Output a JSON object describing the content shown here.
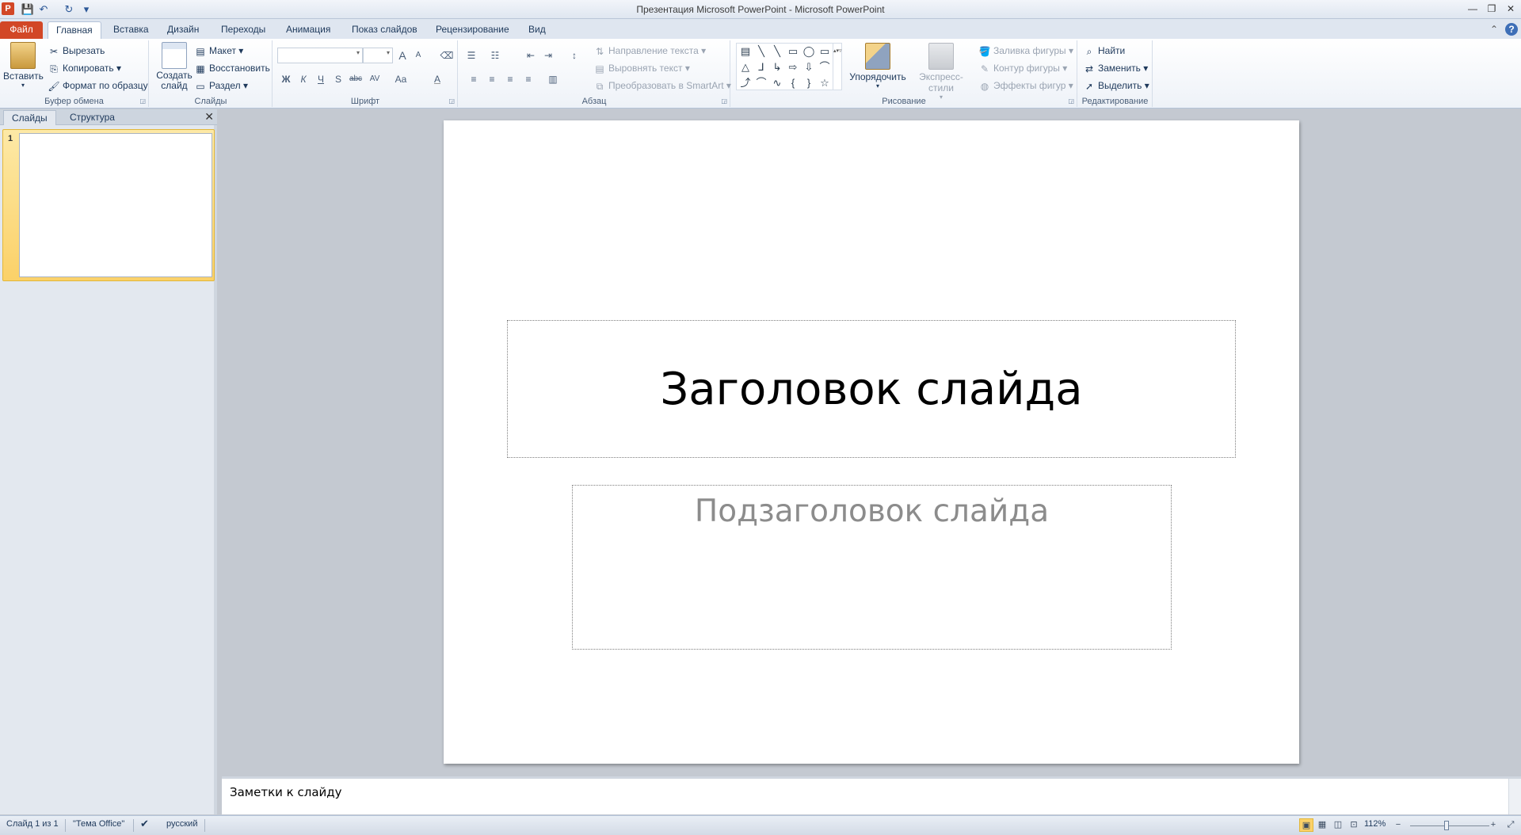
{
  "window": {
    "title": "Презентация Microsoft PowerPoint  -  Microsoft PowerPoint",
    "app_icon": "P",
    "qat": {
      "save_icon": "💾",
      "undo_icon": "↶",
      "redo_icon": "↻",
      "customize_icon": "▾"
    },
    "controls": {
      "minimize": "—",
      "restore": "❐",
      "close": "✕"
    }
  },
  "tabs": {
    "file": "Файл",
    "home": "Главная",
    "insert": "Вставка",
    "design": "Дизайн",
    "transitions": "Переходы",
    "animation": "Анимация",
    "slideshow": "Показ слайдов",
    "review": "Рецензирование",
    "view": "Вид",
    "minimize_ribbon_icon": "⌃",
    "help_icon": "?"
  },
  "ribbon": {
    "clipboard": {
      "label": "Буфер обмена",
      "paste": "Вставить",
      "cut": "Вырезать",
      "copy": "Копировать",
      "format_painter": "Формат по образцу"
    },
    "slides": {
      "label": "Слайды",
      "new_slide_line1": "Создать",
      "new_slide_line2": "слайд",
      "layout": "Макет",
      "reset": "Восстановить",
      "section": "Раздел"
    },
    "font": {
      "label": "Шрифт",
      "bold": "Ж",
      "italic": "К",
      "underline": "Ч",
      "shadow": "S",
      "strike": "abc",
      "spacing": "AV",
      "case": "Aa",
      "color": "A",
      "grow": "A",
      "shrink": "A"
    },
    "paragraph": {
      "label": "Абзац",
      "text_direction": "Направление текста",
      "align_text": "Выровнять текст",
      "smartart": "Преобразовать в SmartArt"
    },
    "drawing": {
      "label": "Рисование",
      "arrange": "Упорядочить",
      "quick_styles": "Экспресс-стили",
      "shape_fill": "Заливка фигуры",
      "shape_outline": "Контур фигуры",
      "shape_effects": "Эффекты фигур",
      "shapes": [
        "▤",
        "╲",
        "╲",
        "▭",
        "◯",
        "▭",
        "△",
        "⅃",
        "↳",
        "⇨",
        "⇩",
        "⌒",
        "⤴",
        "⌒",
        "∿",
        "{",
        "}",
        "☆"
      ]
    },
    "editing": {
      "label": "Редактирование",
      "find": "Найти",
      "replace": "Заменить",
      "select": "Выделить"
    }
  },
  "left_pane": {
    "tab_slides": "Слайды",
    "tab_outline": "Структура",
    "close_icon": "✕",
    "slide_number": "1"
  },
  "slide": {
    "title_placeholder": "Заголовок слайда",
    "subtitle_placeholder": "Подзаголовок слайда"
  },
  "notes": {
    "placeholder": "Заметки к слайду"
  },
  "status": {
    "slide_info": "Слайд 1 из 1",
    "theme": "\"Тема Office\"",
    "language": "русский",
    "zoom": "112%",
    "zoom_out": "−",
    "zoom_in": "+"
  }
}
